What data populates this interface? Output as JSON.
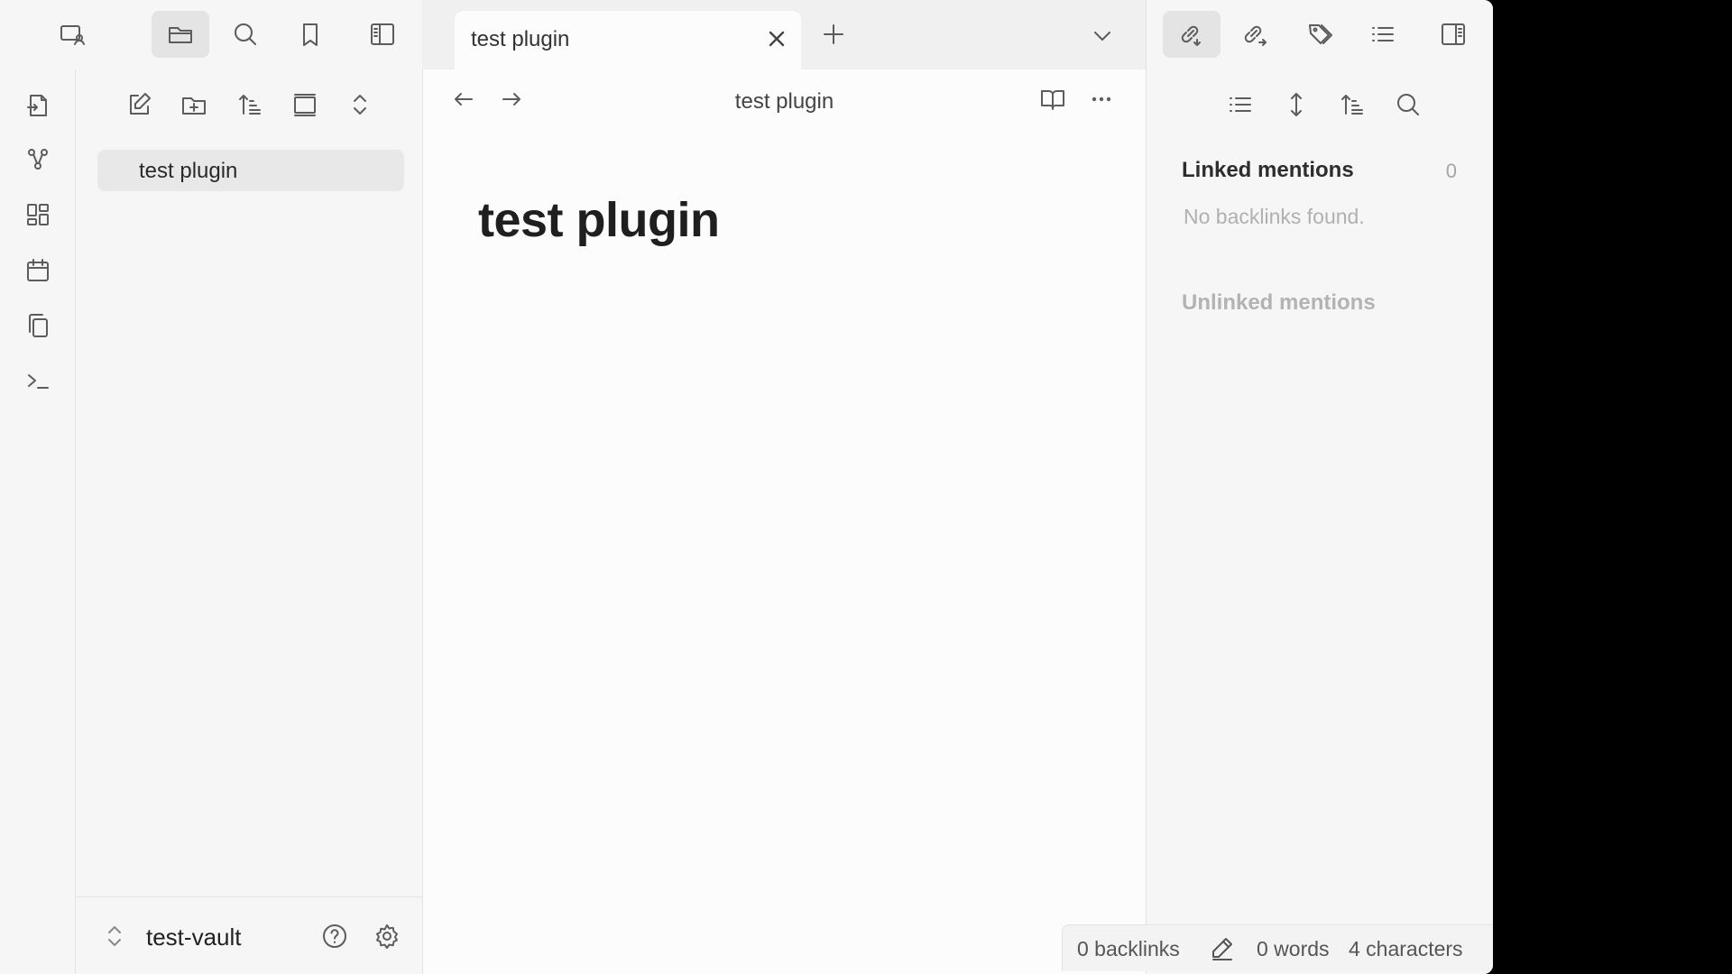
{
  "tab": {
    "title": "test plugin"
  },
  "editor": {
    "view_title": "test plugin",
    "note_title": "test plugin"
  },
  "explorer": {
    "files": [
      {
        "label": "test plugin"
      }
    ],
    "vault_name": "test-vault"
  },
  "backlinks": {
    "linked_title": "Linked mentions",
    "linked_count": "0",
    "no_backlinks": "No backlinks found.",
    "unlinked_title": "Unlinked mentions"
  },
  "status": {
    "backlinks": "0 backlinks",
    "words": "0 words",
    "characters": "4 characters"
  },
  "ribbon_icons": [
    "open-quick-switcher-icon",
    "graph-view-icon",
    "canvas-icon",
    "daily-note-calendar-icon",
    "templates-copy-icon",
    "command-palette-icon"
  ],
  "colors": {
    "background": "#f6f6f6",
    "editor": "#fcfcfc",
    "active_tab": "#e4e4e4",
    "text": "#222222",
    "muted": "#b0b0b0"
  }
}
